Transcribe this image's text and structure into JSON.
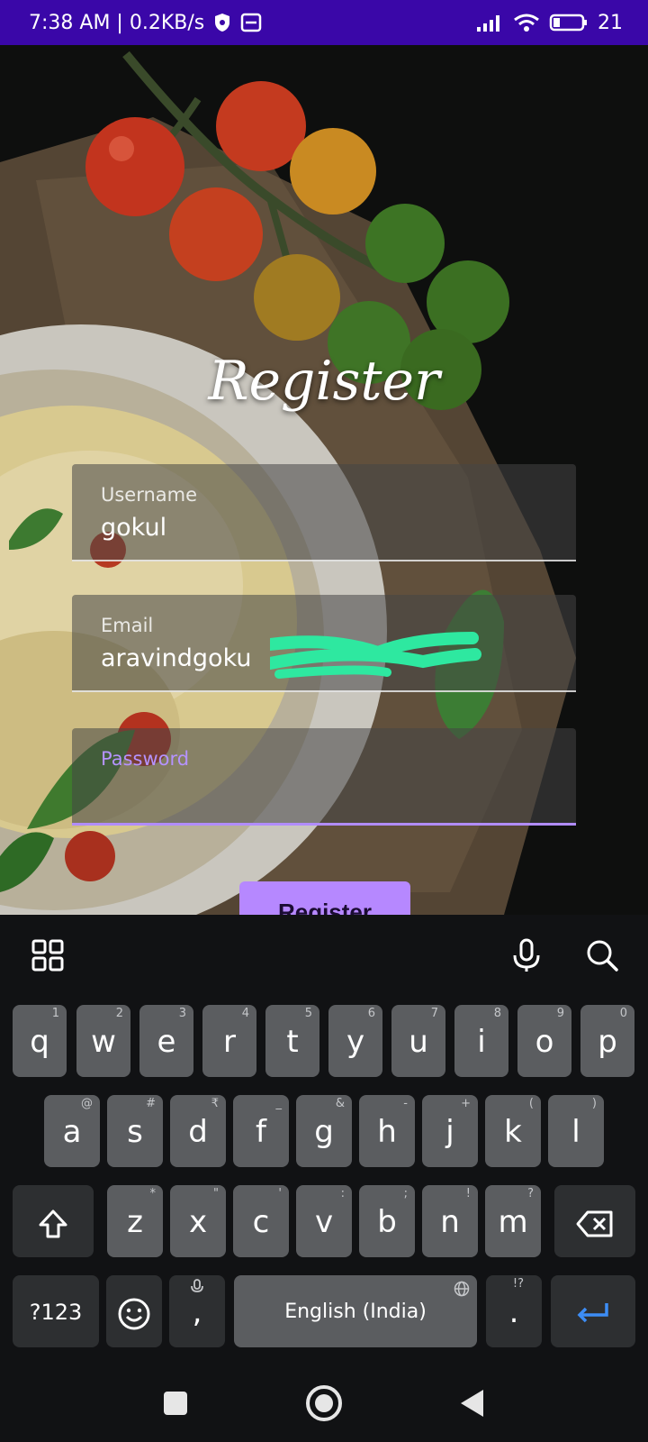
{
  "status_bar": {
    "time_speed": "7:38 AM | 0.2KB/s",
    "battery": "21"
  },
  "page": {
    "title": "Register"
  },
  "form": {
    "username": {
      "label": "Username",
      "value": "gokul"
    },
    "email": {
      "label": "Email",
      "value": "aravindgoku"
    },
    "password": {
      "label": "Password",
      "value": ""
    },
    "submit_label": "Register"
  },
  "keyboard": {
    "row1": [
      {
        "k": "q",
        "h": "1"
      },
      {
        "k": "w",
        "h": "2"
      },
      {
        "k": "e",
        "h": "3"
      },
      {
        "k": "r",
        "h": "4"
      },
      {
        "k": "t",
        "h": "5"
      },
      {
        "k": "y",
        "h": "6"
      },
      {
        "k": "u",
        "h": "7"
      },
      {
        "k": "i",
        "h": "8"
      },
      {
        "k": "o",
        "h": "9"
      },
      {
        "k": "p",
        "h": "0"
      }
    ],
    "row2": [
      {
        "k": "a",
        "h": "@"
      },
      {
        "k": "s",
        "h": "#"
      },
      {
        "k": "d",
        "h": "₹"
      },
      {
        "k": "f",
        "h": "_"
      },
      {
        "k": "g",
        "h": "&"
      },
      {
        "k": "h",
        "h": "-"
      },
      {
        "k": "j",
        "h": "+"
      },
      {
        "k": "k",
        "h": "("
      },
      {
        "k": "l",
        "h": ")"
      }
    ],
    "row3": [
      {
        "k": "z",
        "h": "*"
      },
      {
        "k": "x",
        "h": "\""
      },
      {
        "k": "c",
        "h": "'"
      },
      {
        "k": "v",
        "h": ":"
      },
      {
        "k": "b",
        "h": ";"
      },
      {
        "k": "n",
        "h": "!"
      },
      {
        "k": "m",
        "h": "?"
      }
    ],
    "symbols_label": "?123",
    "comma_label": ",",
    "space_label": "English (India)",
    "period_label": ".",
    "period_hint": "!?",
    "icons": {
      "apps": "grid-icon",
      "mic": "microphone-icon",
      "search": "search-icon",
      "shift": "shift-icon",
      "backspace": "backspace-icon",
      "emoji": "emoji-icon",
      "enter": "enter-icon",
      "globe": "globe-icon"
    }
  },
  "colors": {
    "status_bar_bg": "#3a07a8",
    "accent": "#b688ff",
    "key_bg": "#5b5d60",
    "key_dark_bg": "#2d2f31",
    "enter_icon": "#3d8df5",
    "redaction": "#2ee8a0"
  }
}
